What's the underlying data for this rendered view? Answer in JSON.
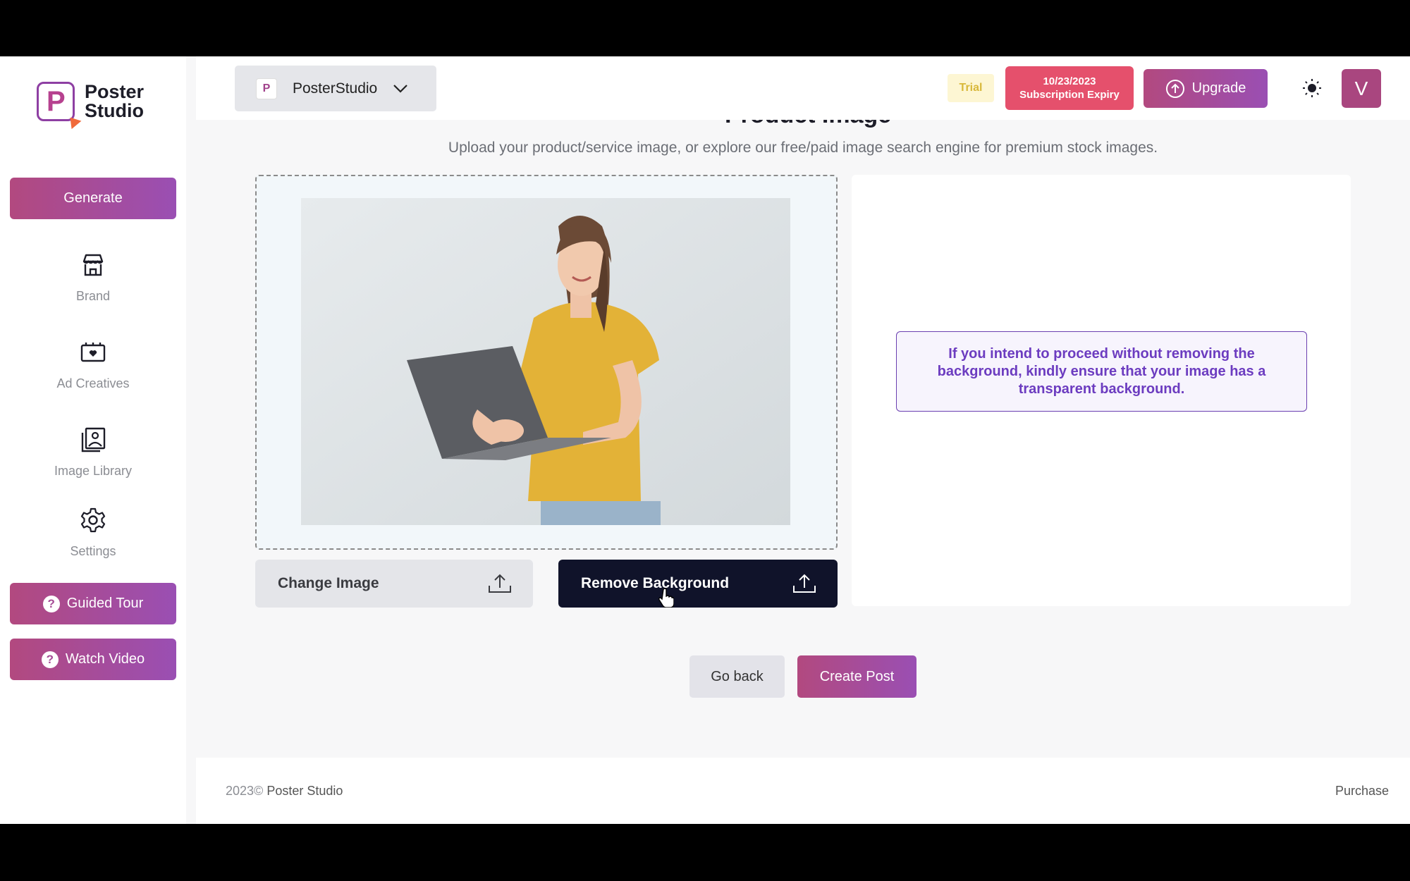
{
  "app": {
    "logo_line1": "Poster",
    "logo_line2": "Studio",
    "logo_letter": "P"
  },
  "sidebar": {
    "generate_label": "Generate",
    "items": [
      {
        "label": "Brand",
        "icon": "store-icon"
      },
      {
        "label": "Ad Creatives",
        "icon": "ad-creatives-icon"
      },
      {
        "label": "Image Library",
        "icon": "image-library-icon"
      },
      {
        "label": "Settings",
        "icon": "gear-icon"
      }
    ],
    "guided_tour_label": "Guided Tour",
    "watch_video_label": "Watch Video"
  },
  "header": {
    "workspace_name": "PosterStudio",
    "workspace_icon_letter": "P",
    "trial_label": "Trial",
    "expiry_date": "10/23/2023",
    "expiry_label": "Subscription Expiry",
    "upgrade_label": "Upgrade",
    "avatar_letter": "V"
  },
  "main": {
    "title": "Product Image",
    "subtitle": "Upload your product/service image, or explore our free/paid image search engine for premium stock images.",
    "change_image_label": "Change Image",
    "remove_background_label": "Remove Background",
    "notice_text": "If you intend to proceed without removing the background, kindly ensure that your image has a transparent background.",
    "go_back_label": "Go back",
    "create_post_label": "Create Post"
  },
  "footer": {
    "year": "2023©",
    "brand": "Poster Studio",
    "purchase_label": "Purchase"
  },
  "colors": {
    "accent_start": "#b2497f",
    "accent_end": "#9a4fb3",
    "expiry_red": "#e5506c",
    "dark_button": "#10132a",
    "notice_purple": "#6c3cc0"
  }
}
